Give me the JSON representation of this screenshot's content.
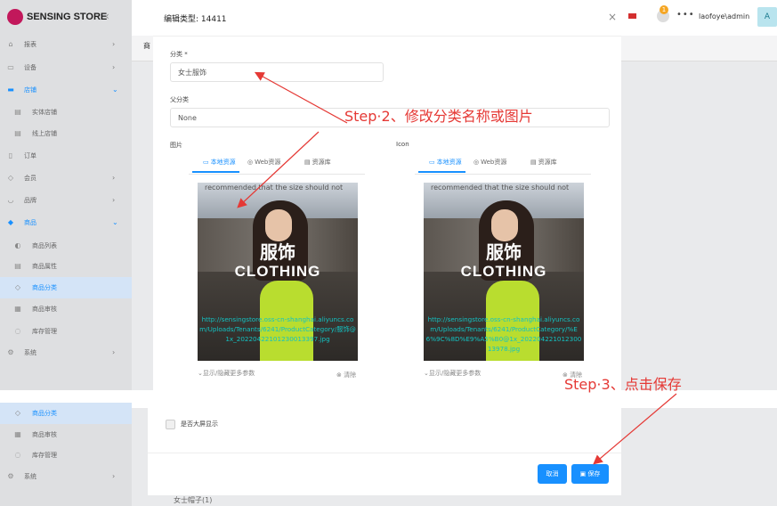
{
  "app": {
    "logo_text": "SENSING STORE",
    "collapse_icon": "‹",
    "user": "laofoye\\admin",
    "avatar_letter": "A",
    "bell_badge": "1",
    "tab_fragment": "商"
  },
  "sidebar": {
    "items": [
      {
        "label": "报表",
        "icon": "chart-icon",
        "glyph": "⌂",
        "arrow": "›"
      },
      {
        "label": "设备",
        "icon": "device-icon",
        "glyph": "▭",
        "arrow": "›"
      },
      {
        "label": "店铺",
        "icon": "store-icon",
        "glyph": "▬",
        "arrow": "⌄"
      },
      {
        "label": "实体店铺",
        "icon": "shop-icon",
        "glyph": "▤"
      },
      {
        "label": "线上店铺",
        "icon": "online-shop-icon",
        "glyph": "▤"
      },
      {
        "label": "订单",
        "icon": "order-icon",
        "glyph": "▯"
      },
      {
        "label": "会员",
        "icon": "member-icon",
        "glyph": "◇",
        "arrow": "›"
      },
      {
        "label": "品牌",
        "icon": "brand-icon",
        "glyph": "◡",
        "arrow": "›"
      },
      {
        "label": "商品",
        "icon": "goods-icon",
        "glyph": "◆",
        "arrow": "⌄"
      },
      {
        "label": "商品列表",
        "icon": "goods-list-icon",
        "glyph": "◐"
      },
      {
        "label": "商品属性",
        "icon": "goods-attr-icon",
        "glyph": "▤"
      },
      {
        "label": "商品分类",
        "icon": "goods-category-icon",
        "glyph": "◇"
      },
      {
        "label": "商品审核",
        "icon": "goods-audit-icon",
        "glyph": "▦"
      },
      {
        "label": "库存管理",
        "icon": "stock-icon",
        "glyph": "◌"
      },
      {
        "label": "系统",
        "icon": "system-icon",
        "glyph": "⚙",
        "arrow": "›"
      }
    ],
    "bottom_items": [
      {
        "label": "商品分类",
        "glyph": "◇"
      },
      {
        "label": "商品审核",
        "glyph": "▦"
      },
      {
        "label": "库存管理",
        "glyph": "◌"
      },
      {
        "label": "系统",
        "glyph": "⚙",
        "arrow": "›"
      }
    ]
  },
  "modal": {
    "title": "编辑类型: 14411",
    "close": "×",
    "category_label": "分类 *",
    "category_value": "女士服饰",
    "parent_label": "父分类",
    "parent_value": "None",
    "image_label": "图片",
    "icon_label": "Icon",
    "tabs": [
      "本地资源",
      "Web资源",
      "资源库"
    ],
    "image": {
      "recommend_text": "recommended that the size should not",
      "zh_text": "服饰",
      "en_text": "CLOTHING",
      "url_image": "http://sensingstore.oss-cn-shanghai.aliyuncs.com/Uploads/Tenants/6241/ProductCategory/服饰@1x_20220422101230013397.jpg",
      "url_icon": "http://sensingstore.oss-cn-shanghai.aliyuncs.com/Uploads/Tenants/6241/ProductCategory/%E6%9C%8D%E9%A5%B0@1x_20220422101230013978.jpg"
    },
    "more_params": "⌄显示/隐藏更多参数",
    "clear": "清除",
    "big_screen_label": "是否大屏显示",
    "cancel": "取消",
    "save": "保存"
  },
  "annotations": {
    "step2": "Step·2、修改分类名称或图片",
    "step3": "Step·3、点击保存",
    "color": "#e53935"
  },
  "bottom_fragment": "女士帽子(1)"
}
